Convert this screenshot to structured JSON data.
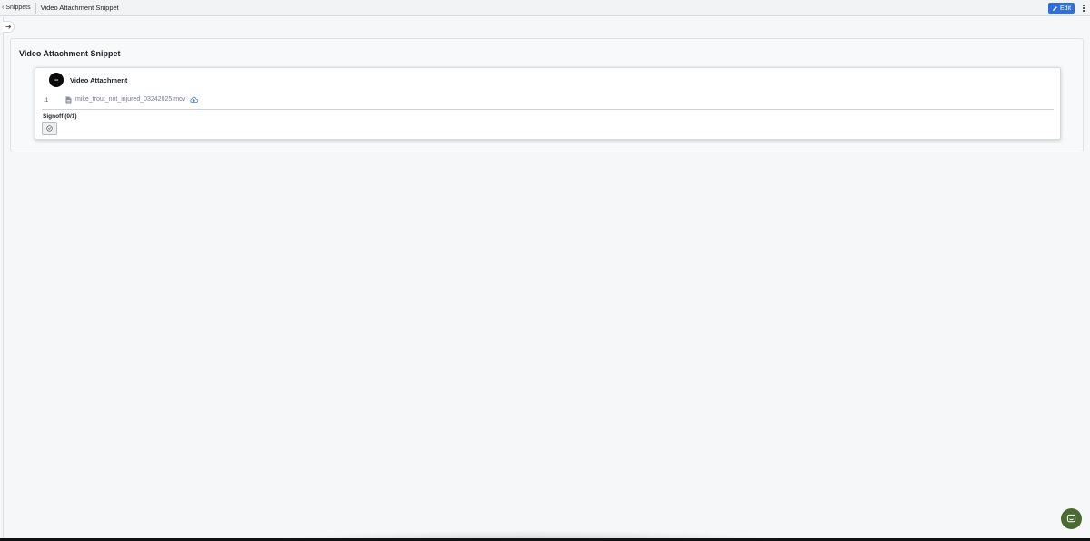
{
  "header": {
    "back_label": "Snippets",
    "page_title": "Video Attachment Snippet",
    "edit_label": "Edit"
  },
  "snippet": {
    "title": "Video Attachment Snippet",
    "card": {
      "badge_text": "--",
      "title": "Video Attachment",
      "row_index": ".1",
      "file_name": "mike_trout_not_injured_03242025.mov",
      "signoff_label": "Signoff (0/1)"
    }
  },
  "icons": {
    "back": "chevron-left-icon",
    "edit": "pencil-icon",
    "more": "more-vertical-icon",
    "expand": "arrow-right-icon",
    "file": "file-icon",
    "download": "cloud-download-icon",
    "signoff": "check-circle-icon",
    "chat": "chat-icon"
  },
  "colors": {
    "accent": "#2d6fe0",
    "chat": "#4a6a32",
    "badge": "#0b0b0b",
    "background": "#f6f7f9"
  }
}
